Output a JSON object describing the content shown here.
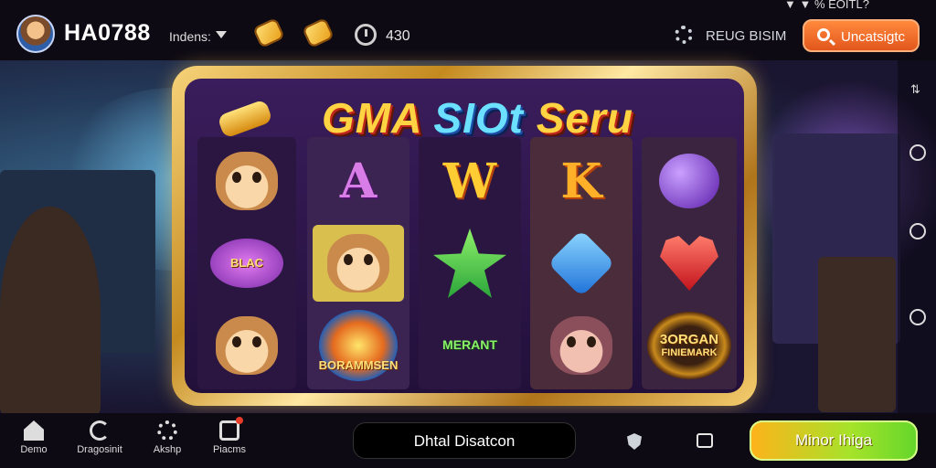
{
  "topbar": {
    "brand": "HA0788",
    "language": "Indens:",
    "counter": "430",
    "register_label": "REUG BISIM",
    "search_button": "Uncatsigtc",
    "status": "▼ ▼ % EOITL?"
  },
  "game": {
    "title_part1": "GMA ",
    "title_part2": "SIOt ",
    "title_part3": "Seru",
    "reels": [
      {
        "top": "scroll-symbol",
        "middle": "gem-badge",
        "bottom": "lion-symbol"
      },
      {
        "top": "letter-a",
        "middle": "lion-symbol",
        "bottom": "badge-bonus"
      },
      {
        "top": "letter-w",
        "middle": "star-symbol",
        "bottom": "badge-merant"
      },
      {
        "top": "letter-k",
        "middle": "blue-gem",
        "bottom": "wolf-symbol"
      },
      {
        "top": "purple-orb",
        "middle": "heart-gem",
        "bottom": "badge-bonus2"
      }
    ],
    "letter_a": "A",
    "letter_w": "W",
    "letter_k": "K",
    "badge_bonus": "BORAMMSEN",
    "badge_merant": "MERANT",
    "badge_bonus2_line1": "3ORGAN",
    "badge_bonus2_line2": "FINIEMARK",
    "badge_gem": "BLAC"
  },
  "bottombar": {
    "nav": [
      {
        "label": "Demo",
        "icon": "home-icon"
      },
      {
        "label": "Dragosinit",
        "icon": "history-icon"
      },
      {
        "label": "Akshp",
        "icon": "settings-icon"
      },
      {
        "label": "Piacms",
        "icon": "message-icon"
      }
    ],
    "center_pill": "Dhtal Disatcon",
    "cta_button": "Minor Ihiga"
  },
  "colors": {
    "accent_orange": "#e2561c",
    "cta_green": "#63d62a",
    "frame_gold": "#c48a1f"
  }
}
